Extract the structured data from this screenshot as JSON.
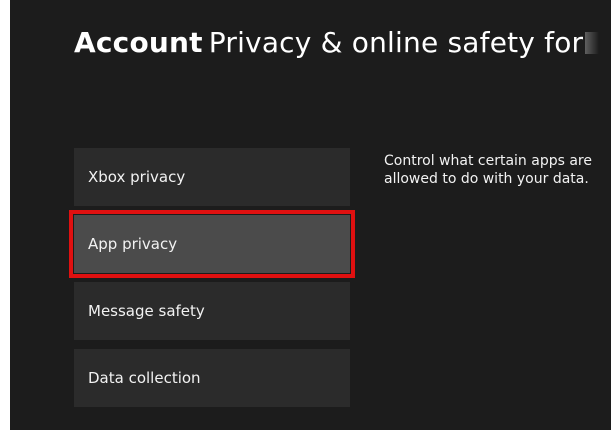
{
  "header": {
    "section": "Account",
    "title": "Privacy & online safety for"
  },
  "menu": {
    "items": [
      {
        "label": "Xbox privacy"
      },
      {
        "label": "App privacy",
        "selected": true
      },
      {
        "label": "Message safety"
      },
      {
        "label": "Data collection"
      }
    ]
  },
  "description": {
    "line1": "Control what certain apps are",
    "line2": "allowed to do with your data."
  },
  "colors": {
    "background": "#1c1c1c",
    "tile": "#2b2b2b",
    "tile_selected": "#4b4b4b",
    "highlight_border": "#e01010"
  }
}
